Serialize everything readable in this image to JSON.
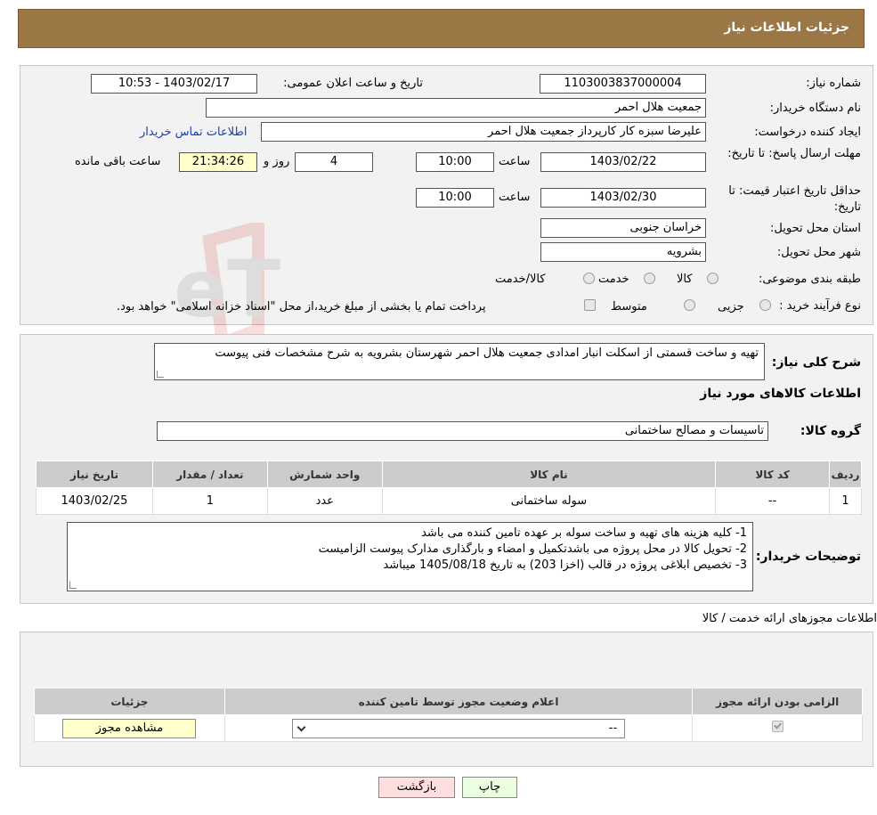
{
  "header": {
    "title": "جزئیات اطلاعات نیاز"
  },
  "info": {
    "need_number_label": "شماره نیاز:",
    "need_number": "1103003837000004",
    "announce_label": "تاریخ و ساعت اعلان عمومی:",
    "announce_value": "1403/02/17 - 10:53",
    "buyer_org_label": "نام دستگاه خریدار:",
    "buyer_org": "جمعیت هلال احمر",
    "requester_label": "ایجاد کننده درخواست:",
    "requester": "علیرضا  سبزه کار کارپرداز جمعیت هلال احمر",
    "contact_link": "اطلاعات تماس خریدار",
    "deadline_label": "مهلت ارسال پاسخ: تا تاریخ:",
    "deadline_date": "1403/02/22",
    "time_label": "ساعت",
    "deadline_time": "10:00",
    "days_value": "4",
    "days_label": "روز و",
    "remaining_time": "21:34:26",
    "remaining_label": "ساعت باقی مانده",
    "validity_label": "حداقل تاریخ اعتبار قیمت: تا تاریخ:",
    "validity_date": "1403/02/30",
    "validity_time": "10:00",
    "province_label": "استان محل تحویل:",
    "province": "خراسان جنوبی",
    "city_label": "شهر محل تحویل:",
    "city": "بشرویه",
    "category_label": "طبقه بندی موضوعی:",
    "category_options": [
      "کالا",
      "خدمت",
      "کالا/خدمت"
    ],
    "process_label": "نوع فرآیند خرید :",
    "process_options": [
      "جزیی",
      "متوسط"
    ],
    "process_note": "پرداخت تمام یا بخشی از مبلغ خرید،از محل \"اسناد خزانه اسلامی\" خواهد بود."
  },
  "summary": {
    "label": "شرح کلی نیاز:",
    "text": "تهیه و ساخت قسمتی از اسکلت انبار امدادی جمعیت هلال احمر شهرستان بشرویه به شرح مشخصات فنی پیوست",
    "goods_title": "اطلاعات کالاهای مورد نیاز",
    "group_label": "گروه کالا:",
    "group_value": "تاسیسات و مصالح ساختمانی",
    "table": {
      "headers": [
        "ردیف",
        "کد کالا",
        "نام کالا",
        "واحد شمارش",
        "تعداد / مقدار",
        "تاریخ نیاز"
      ],
      "row": [
        "1",
        "--",
        "سوله ساختمانی",
        "عدد",
        "1",
        "1403/02/25"
      ]
    },
    "buyer_notes_label": "توضیحات خریدار:",
    "buyer_notes": [
      "1- کلیه هزینه های تهیه و ساخت سوله بر عهده تامین کننده می باشد",
      "2- تحویل کالا در محل پروژه می باشدتکمیل و امضاء و بارگذاری مدارک پیوست الزامیست",
      "3- تخصیص ابلاغی پروژه در قالب (اخزا 203) به تاریخ 1405/08/18 میباشد"
    ]
  },
  "licenses": {
    "title": "اطلاعات مجوزهای ارائه خدمت / کالا",
    "headers": [
      "الزامی بودن ارائه مجوز",
      "اعلام وضعیت مجوز توسط تامین کننده",
      "جزئیات"
    ],
    "select_value": "--",
    "view_button": "مشاهده مجوز"
  },
  "buttons": {
    "print": "چاپ",
    "back": "بازگشت"
  },
  "watermark": {
    "text": "AriaTender.neT"
  },
  "colors": {
    "header": "#9b7746",
    "link": "#1a40b8",
    "back_btn": "#ffdede",
    "print_btn": "#eaffdf"
  }
}
